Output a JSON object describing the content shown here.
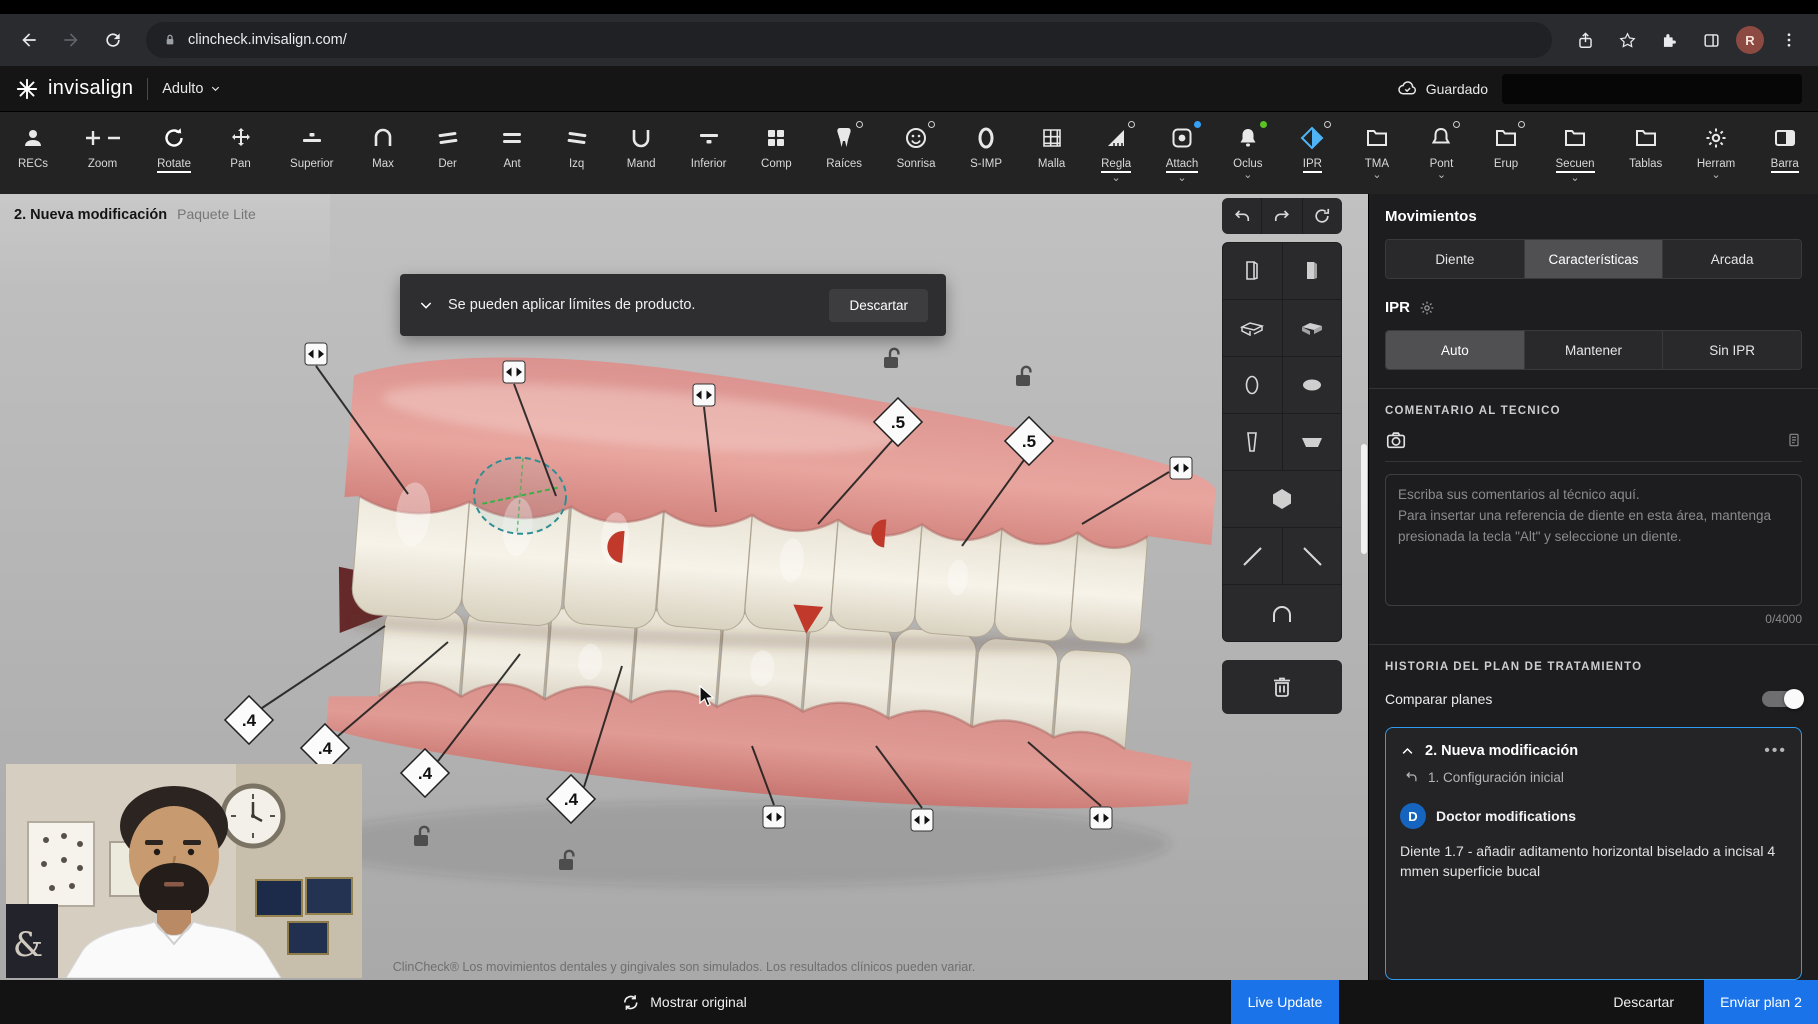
{
  "browser": {
    "url": "clincheck.invisalign.com/",
    "profile_initial": "R"
  },
  "header": {
    "brand": "invisalign",
    "patient_type": "Adulto",
    "save_status": "Guardado"
  },
  "toolbar": {
    "items": [
      {
        "label": "RECs",
        "icon": "person-icon"
      },
      {
        "label": "Zoom",
        "icon": "zoom-icon"
      },
      {
        "label": "Rotate",
        "icon": "rotate-icon",
        "active": true
      },
      {
        "label": "Pan",
        "icon": "pan-icon"
      },
      {
        "label": "Superior",
        "icon": "superior-icon"
      },
      {
        "label": "Max",
        "icon": "arch-max-icon"
      },
      {
        "label": "Der",
        "icon": "side-der-icon"
      },
      {
        "label": "Ant",
        "icon": "side-ant-icon"
      },
      {
        "label": "Izq",
        "icon": "side-izq-icon"
      },
      {
        "label": "Mand",
        "icon": "arch-mand-icon"
      },
      {
        "label": "Inferior",
        "icon": "inferior-icon"
      },
      {
        "label": "Comp",
        "icon": "comp-icon"
      },
      {
        "label": "Raíces",
        "icon": "roots-icon",
        "badge": "ring"
      },
      {
        "label": "Sonrisa",
        "icon": "smile-icon",
        "badge": "ring"
      },
      {
        "label": "S-IMP",
        "icon": "simp-icon"
      },
      {
        "label": "Malla",
        "icon": "mesh-icon"
      },
      {
        "label": "Regla",
        "icon": "ruler-icon",
        "badge": "ring",
        "caret": true,
        "active": true
      },
      {
        "label": "Attach",
        "icon": "attach-icon",
        "badge": "blue",
        "caret": true,
        "active": true
      },
      {
        "label": "Oclus",
        "icon": "occlus-icon",
        "badge": "green",
        "caret": true
      },
      {
        "label": "IPR",
        "icon": "ipr-diamond-icon",
        "badge": "ring",
        "active": true
      },
      {
        "label": "TMA",
        "icon": "folder-icon",
        "caret": true
      },
      {
        "label": "Pont",
        "icon": "pont-icon",
        "badge": "ring",
        "caret": true
      },
      {
        "label": "Erup",
        "icon": "folder-icon",
        "badge": "ring"
      },
      {
        "label": "Secuen",
        "icon": "folder-icon",
        "caret": true,
        "active": true
      },
      {
        "label": "Tablas",
        "icon": "folder-icon"
      },
      {
        "label": "Herram",
        "icon": "gear-icon",
        "caret": true
      },
      {
        "label": "Barra",
        "icon": "barra-icon",
        "active": true
      }
    ]
  },
  "canvas": {
    "title": "2. Nueva modificación",
    "subtitle": "Paquete Lite",
    "toast": {
      "message": "Se pueden aplicar límites de producto.",
      "action": "Descartar"
    },
    "ipr_labels": [
      ".5",
      ".5",
      ".4",
      ".4",
      ".4",
      ".4"
    ],
    "disclaimer": "ClinCheck® Los movimientos dentales y gingivales son simulados. Los resultados clínicos pueden variar."
  },
  "palette": {
    "history": [
      "undo-icon",
      "redo-icon",
      "reset-view-icon"
    ],
    "tools": [
      {
        "icon": "attachment-box-vertical-outline-icon"
      },
      {
        "icon": "attachment-box-vertical-filled-icon"
      },
      {
        "icon": "attachment-slab-outline-icon"
      },
      {
        "icon": "attachment-slab-filled-icon"
      },
      {
        "icon": "attachment-ellipse-vertical-icon"
      },
      {
        "icon": "attachment-ellipse-horizontal-icon"
      },
      {
        "icon": "attachment-trapezoid-vertical-icon"
      },
      {
        "icon": "attachment-trapezoid-horizontal-icon"
      },
      {
        "icon": "attachment-hexagon-icon",
        "wide": true
      },
      {
        "icon": "cut-line-forward-icon"
      },
      {
        "icon": "cut-line-backward-icon"
      },
      {
        "icon": "arch-arc-icon",
        "wide": true
      }
    ],
    "trash": "trash-icon"
  },
  "sidebar": {
    "title": "Movimientos",
    "tabs": [
      {
        "label": "Diente"
      },
      {
        "label": "Características",
        "active": true
      },
      {
        "label": "Arcada"
      }
    ],
    "ipr_section": {
      "label": "IPR",
      "options": [
        {
          "label": "Auto",
          "active": true
        },
        {
          "label": "Mantener"
        },
        {
          "label": "Sin IPR"
        }
      ]
    },
    "comment_section": {
      "title": "COMENTARIO AL TECNICO",
      "placeholder": "Escriba sus comentarios al técnico aquí.\nPara insertar una referencia de diente en esta área, mantenga presionada la tecla \"Alt\" y seleccione un diente.",
      "counter": "0/4000"
    },
    "history_section": {
      "title": "HISTORIA DEL PLAN DE TRATAMIENTO",
      "compare_label": "Comparar planes",
      "plan": {
        "title": "2. Nueva modificación",
        "parent": "1. Configuración inicial",
        "author_initial": "D",
        "author": "Doctor modifications",
        "note": "Diente 1.7 - añadir aditamento horizontal biselado a incisal 4 mmen superficie bucal"
      }
    }
  },
  "bottombar": {
    "show_original": "Mostrar original",
    "live_update": "Live Update",
    "discard": "Descartar",
    "send": "Enviar plan 2"
  },
  "colors": {
    "accent": "#1a73e8",
    "attachment_red": "#c0392b",
    "gum_pink": "#e0968f",
    "canvas_gray": "#b5b5b5"
  }
}
